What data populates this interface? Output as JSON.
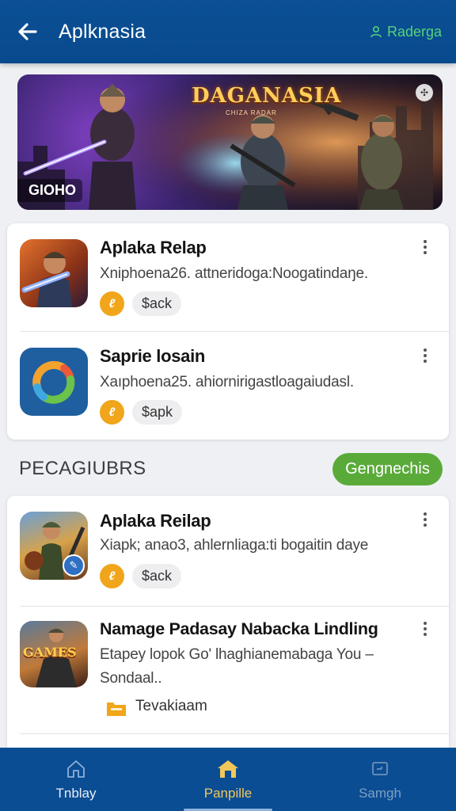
{
  "header": {
    "title": "Aplknasia",
    "action_label": "Raderga"
  },
  "banner": {
    "logo_text": "DAGANASIA",
    "logo_subtitle": "CHIZA RADAR",
    "badge_text": "GIOHO"
  },
  "featured_list": {
    "items": [
      {
        "name": "Aplaka Relap",
        "description": "Xniphoena26. attneridoga:Noogatindaŋe.",
        "chip_label": "$ack"
      },
      {
        "name": "Saprie losain",
        "description": "Xaıphoena25. ahiornirigastloagaiudasl.",
        "chip_label": "$apk"
      }
    ]
  },
  "section": {
    "title": "PECAGIUBRS",
    "button_label": "Gengnechis"
  },
  "second_list": {
    "items": [
      {
        "name": "Aplaka Reilap",
        "description": "Xiapk; anao3, ahlernliaga:ti bogaitin daye",
        "chip_label": "$ack"
      },
      {
        "name": "Namage Padasay Nabacka Lindling",
        "description_line1": "Etapey lopok Go' lhaghianemabaga You –",
        "description_line2": "Sondaal..",
        "tag_label": "Tevakiaam",
        "icon_text": "GAMES"
      }
    ]
  },
  "bottom_nav": {
    "items": [
      {
        "label": "Tnblay"
      },
      {
        "label": "Panpille"
      },
      {
        "label": "Samgh"
      }
    ]
  },
  "colors": {
    "primary": "#0a4d93",
    "accent_green": "#5aaa3a",
    "coin": "#f0a51a",
    "active_nav": "#f2c75a"
  }
}
